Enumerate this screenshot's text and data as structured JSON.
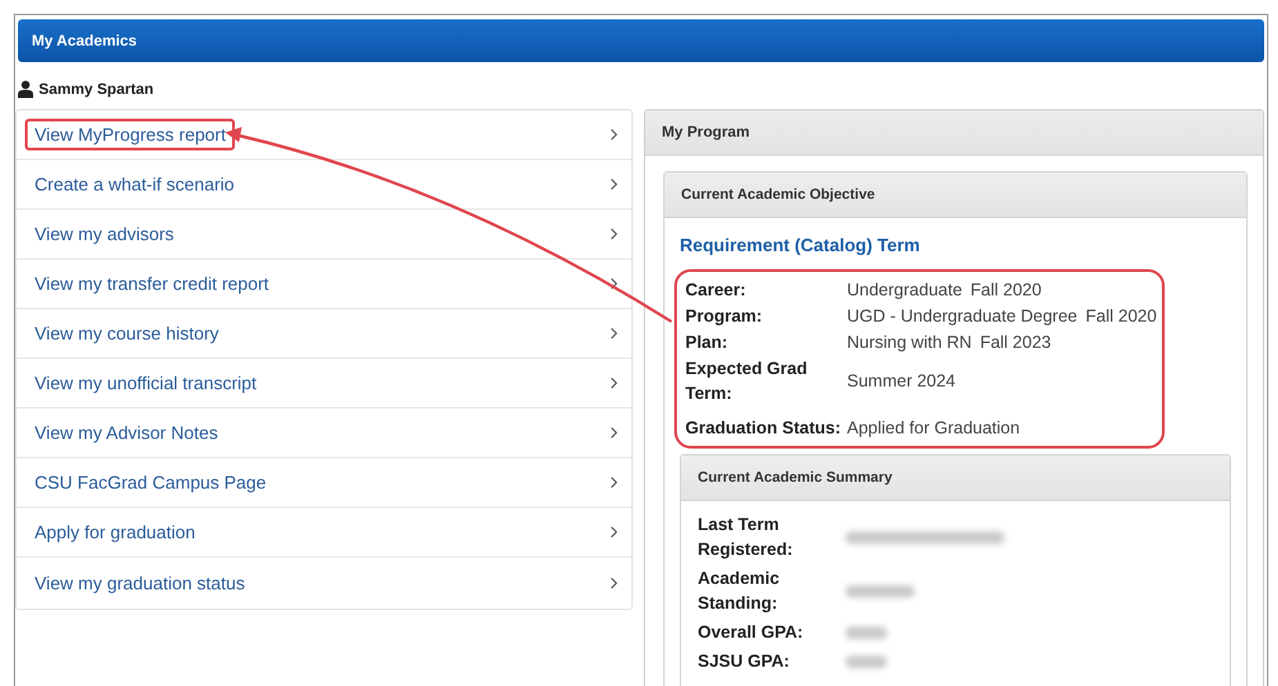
{
  "page": {
    "title": "My Academics"
  },
  "user": {
    "name": "Sammy Spartan"
  },
  "links": [
    {
      "label": "View MyProgress report",
      "highlighted": true
    },
    {
      "label": "Create a what-if scenario",
      "highlighted": false
    },
    {
      "label": "View my advisors",
      "highlighted": false
    },
    {
      "label": "View my transfer credit report",
      "highlighted": false
    },
    {
      "label": "View my course history",
      "highlighted": false
    },
    {
      "label": "View my unofficial transcript",
      "highlighted": false
    },
    {
      "label": "View my Advisor Notes",
      "highlighted": false
    },
    {
      "label": "CSU FacGrad Campus Page",
      "highlighted": false
    },
    {
      "label": "Apply for graduation",
      "highlighted": false
    },
    {
      "label": "View my graduation status",
      "highlighted": false
    }
  ],
  "program": {
    "title": "My Program",
    "objective": {
      "title": "Current Academic Objective",
      "subtitle": "Requirement (Catalog) Term",
      "highlighted": true,
      "fields": [
        {
          "label": "Career:",
          "value": "Undergraduate",
          "term": "Fall 2020"
        },
        {
          "label": "Program:",
          "value": "UGD - Undergraduate Degree",
          "term": "Fall 2020"
        },
        {
          "label": "Plan:",
          "value": "Nursing with RN",
          "term": "Fall 2023"
        },
        {
          "label": "Expected Grad Term:",
          "value": "Summer 2024"
        },
        {
          "label": "Graduation Status:",
          "value": "Applied for Graduation"
        }
      ]
    },
    "summary": {
      "title": "Current Academic Summary",
      "fields": [
        {
          "label": "Last Term Registered:"
        },
        {
          "label": "Academic Standing:"
        },
        {
          "label": "Overall GPA:"
        },
        {
          "label": "SJSU GPA:"
        }
      ]
    }
  }
}
